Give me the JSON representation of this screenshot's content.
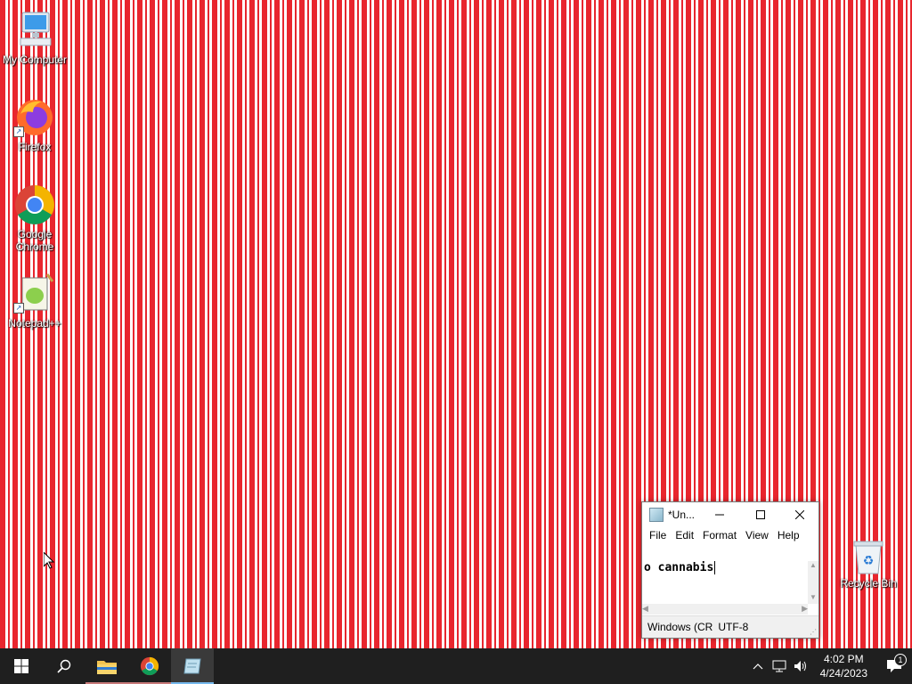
{
  "desktop": {
    "icons": [
      {
        "label": "My Computer",
        "icon": "computer-icon"
      },
      {
        "label": "Firefox",
        "icon": "firefox-icon"
      },
      {
        "label": "Google Chrome",
        "icon": "chrome-icon"
      },
      {
        "label": "Notepad++",
        "icon": "notepadpp-icon"
      },
      {
        "label": "Recycle Bin",
        "icon": "recycle-bin-icon"
      }
    ]
  },
  "notepad": {
    "title": "*Un...",
    "menu": [
      "File",
      "Edit",
      "Format",
      "View",
      "Help"
    ],
    "content": "o cannabis",
    "status": {
      "line_ending": "Windows (CR",
      "encoding": "UTF-8"
    }
  },
  "taskbar": {
    "clock_time": "4:02 PM",
    "clock_date": "4/24/2023",
    "notification_count": "1",
    "colors": {
      "background": "#1f1f1f",
      "accent": "#76b9ed"
    }
  }
}
